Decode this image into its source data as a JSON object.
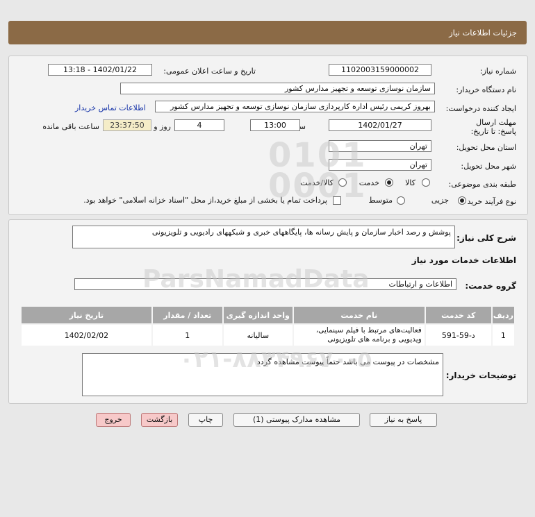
{
  "header": {
    "title": "جزئیات اطلاعات نیاز"
  },
  "info": {
    "need_number_label": "شماره نیاز:",
    "need_number": "1102003159000002",
    "announce_label": "تاریخ و ساعت اعلان عمومی:",
    "announce_value": "1402/01/22 - 13:18",
    "buyer_org_label": "نام دستگاه خریدار:",
    "buyer_org": "سازمان نوسازی  توسعه و تجهیز مدارس کشور",
    "creator_label": "ایجاد کننده درخواست:",
    "creator": "بهروز کریمی رئیس اداره کارپردازی سازمان نوسازی  توسعه و تجهیز مدارس کشور",
    "contact_link": "اطلاعات تماس خریدار",
    "deadline_label": "مهلت ارسال پاسخ: تا تاریخ:",
    "deadline_date": "1402/01/27",
    "time_label": "ساعت",
    "deadline_time": "13:00",
    "days": "4",
    "days_label": "روز و",
    "remaining": "23:37:50",
    "remaining_label": "ساعت باقی مانده",
    "province_label": "استان محل تحویل:",
    "province": "تهران",
    "city_label": "شهر محل تحویل:",
    "city": "تهران",
    "category_label": "طبقه بندی موضوعی:",
    "category_options": [
      "کالا",
      "خدمت",
      "کالا/خدمت"
    ],
    "category_selected": "خدمت",
    "process_label": "نوع فرآیند خرید :",
    "process_options": [
      "جزیی",
      "متوسط"
    ],
    "process_selected": "جزیی",
    "payment_note": "پرداخت تمام یا بخشی از مبلغ خرید،از محل \"اسناد خزانه اسلامی\" خواهد بود."
  },
  "details": {
    "summary_label": "شرح کلی نیاز:",
    "summary": "پوشش و رصد اخبار سازمان و پایش رسانه ها، پایگاههای خبری و شبکههای رادیویی و تلویزیونی",
    "services_heading": "اطلاعات خدمات مورد نیاز",
    "service_group_label": "گروه خدمت:",
    "service_group": "اطلاعات و ارتباطات",
    "table": {
      "headers": [
        "ردیف",
        "کد خدمت",
        "نام خدمت",
        "واحد اندازه گیری",
        "تعداد / مقدار",
        "تاریخ نیاز"
      ],
      "rows": [
        [
          "1",
          "د-59-591",
          "فعالیت‌های مرتبط با فیلم سینمایی، ویدیویی و برنامه های تلویزیونی",
          "سالیانه",
          "1",
          "1402/02/02"
        ]
      ]
    },
    "buyer_notes_label": "توضیحات خریدار:",
    "buyer_notes": "مشخصات در پیوست می باشد حتماً پیوست مشاهده گردد"
  },
  "buttons": {
    "reply": "پاسخ به نیاز",
    "attachments": "مشاهده مدارک پیوستی (1)",
    "print": "چاپ",
    "back": "بازگشت",
    "exit": "خروج"
  },
  "watermark": {
    "brand": "ParsNamadData",
    "phone": "۰۲۱-۸۸۳۴۹۶۷۰-۵"
  }
}
